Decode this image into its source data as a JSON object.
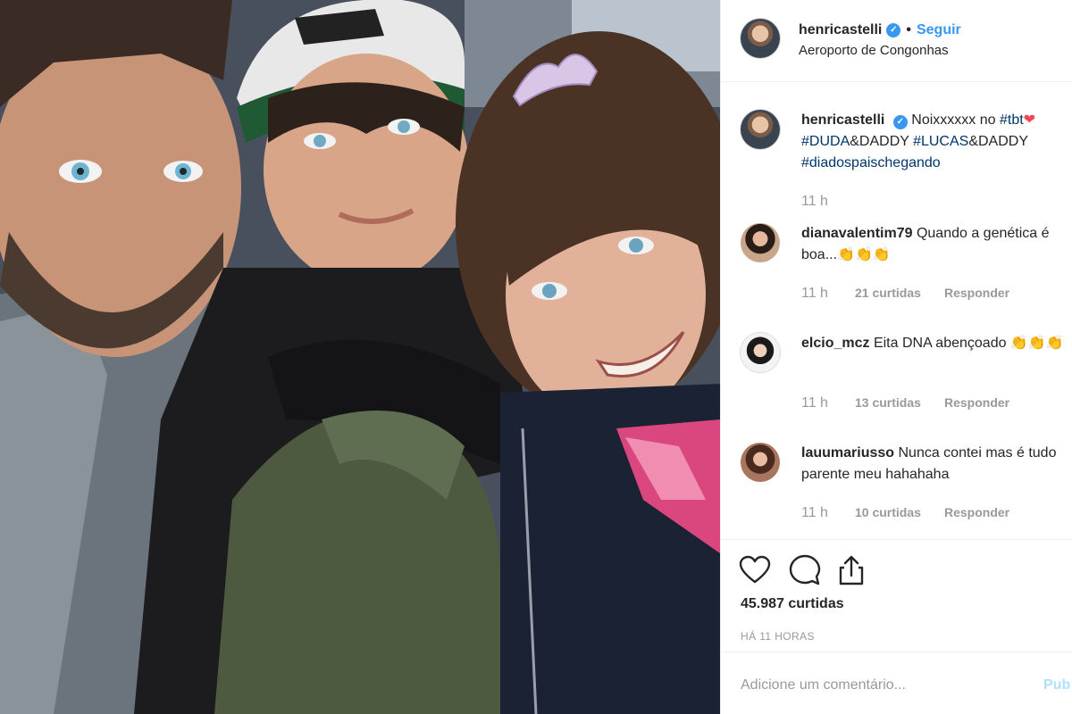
{
  "photo": {
    "alt_icon": "post-photo"
  },
  "header": {
    "username": "henricastelli",
    "verified_icon": "verified-badge-icon",
    "separator": "•",
    "follow_label": "Seguir",
    "location": "Aeroporto de Congonhas"
  },
  "caption": {
    "username": "henricastelli",
    "text": "Noixxxxxx no",
    "hashtag1": "#tbt",
    "emoji": "❤",
    "line2_tag1": "#DUDA",
    "line2_text1": "&DADDY ",
    "line2_tag2": "#LUCAS",
    "line2_text2": "&DADDY",
    "line3_tag": "#diadospaischegando",
    "time": "11 h"
  },
  "comments": [
    {
      "username": "dianavalentim79",
      "text": "Quando a genética é boa...👏👏👏",
      "time": "11 h",
      "likes": "21 curtidas",
      "reply": "Responder"
    },
    {
      "username": "elcio_mcz",
      "text": "Eita DNA abençoado 👏👏👏",
      "time": "11 h",
      "likes": "13 curtidas",
      "reply": "Responder"
    },
    {
      "username": "lauumariusso",
      "text": "Nunca contei mas é tudo parente meu hahahaha",
      "time": "11 h",
      "likes": "10 curtidas",
      "reply": "Responder"
    }
  ],
  "actions": {
    "like_icon": "heart-icon",
    "comment_icon": "comment-icon",
    "share_icon": "share-icon",
    "likes_total": "45.987 curtidas",
    "posted_ago": "HÁ 11 HORAS"
  },
  "add_comment": {
    "placeholder": "Adicione um comentário...",
    "publish_label": "Pub"
  },
  "colors": {
    "accent": "#3897f0",
    "hashtag": "#003569",
    "muted": "#999999",
    "border": "#efefef"
  }
}
